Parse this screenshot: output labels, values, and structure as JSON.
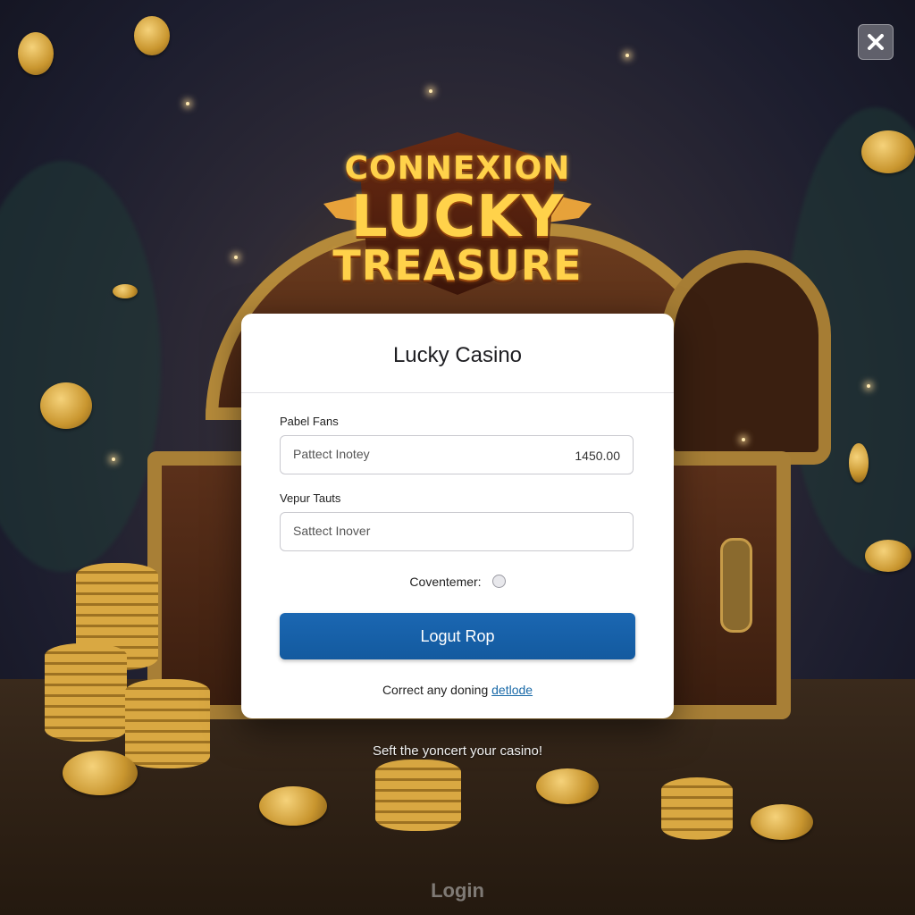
{
  "logo": {
    "line1": "CONNEXION",
    "line2": "LUCKY",
    "line3": "TREASURE"
  },
  "close_icon": "close-icon",
  "card": {
    "title": "Lucky Casino",
    "field1": {
      "label": "Pabel Fans",
      "placeholder": "Pattect Inotey",
      "amount": "1450.00"
    },
    "field2": {
      "label": "Vepur Tauts",
      "placeholder": "Sattect Inover"
    },
    "checkbox_label": "Coventemer:",
    "submit_label": "Logut Rop",
    "footer_text": "Correct any doning",
    "footer_link": "detlode"
  },
  "tagline": "Seft the yoncert your casino!",
  "bottom_label": "Login",
  "colors": {
    "primary_button": "#1b67b2",
    "link": "#1a6aa8",
    "logo_gold": "#ffd24a"
  }
}
